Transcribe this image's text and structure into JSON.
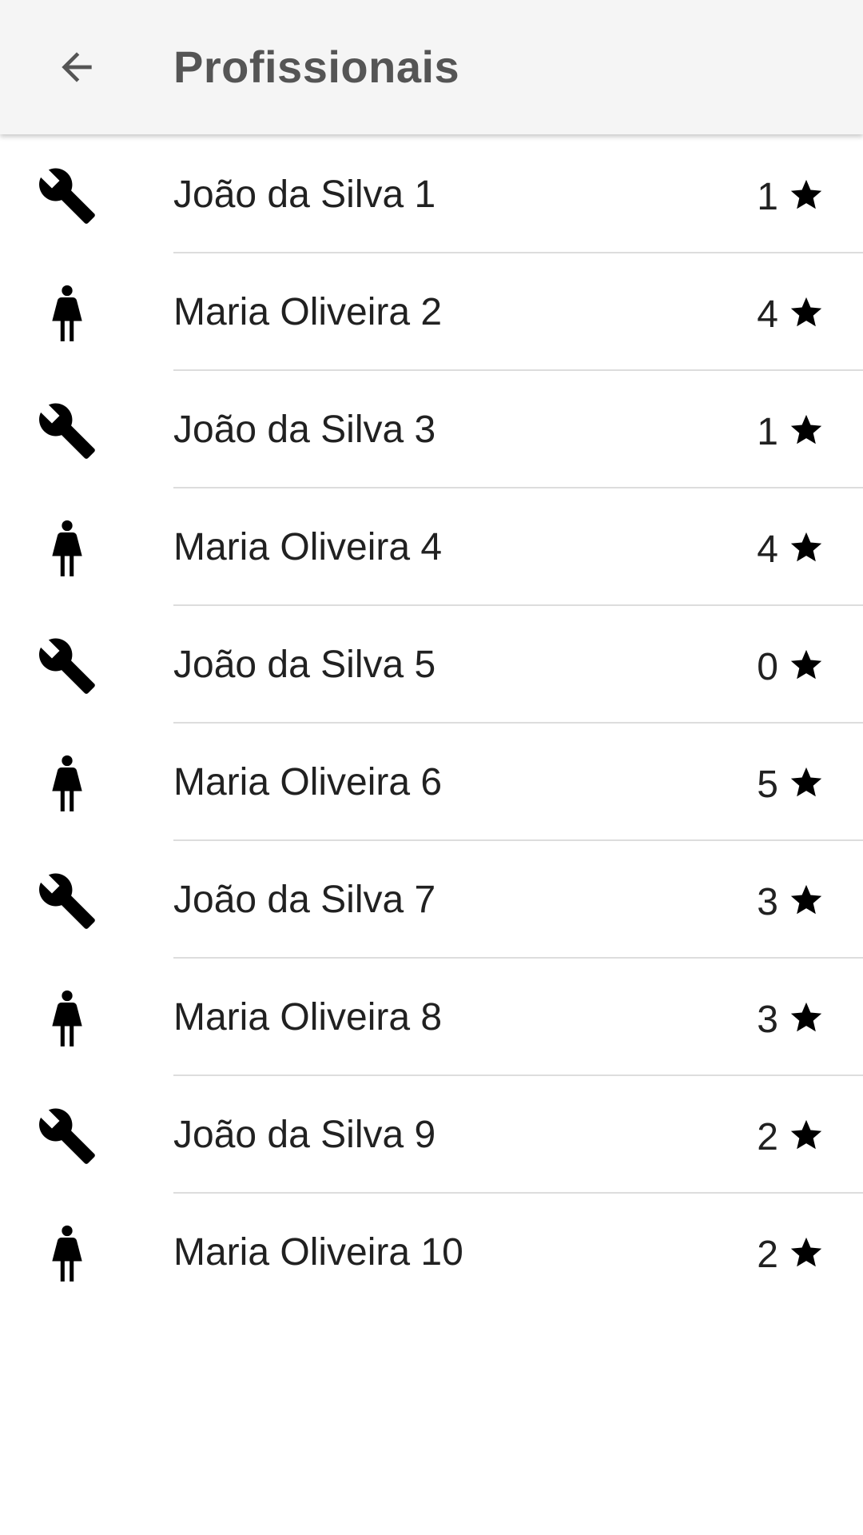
{
  "app_bar": {
    "title": "Profissionais",
    "back_icon": "arrow-back-icon"
  },
  "colors": {
    "app_bar_background": "#f5f5f5",
    "title_text": "#555555",
    "item_text": "#212121",
    "divider": "#dddddd"
  },
  "professionals": [
    {
      "name": "João da Silva 1",
      "rating": "1",
      "icon": "wrench-icon"
    },
    {
      "name": "Maria Oliveira 2",
      "rating": "4",
      "icon": "woman-icon"
    },
    {
      "name": "João da Silva 3",
      "rating": "1",
      "icon": "wrench-icon"
    },
    {
      "name": "Maria Oliveira 4",
      "rating": "4",
      "icon": "woman-icon"
    },
    {
      "name": "João da Silva 5",
      "rating": "0",
      "icon": "wrench-icon"
    },
    {
      "name": "Maria Oliveira 6",
      "rating": "5",
      "icon": "woman-icon"
    },
    {
      "name": "João da Silva 7",
      "rating": "3",
      "icon": "wrench-icon"
    },
    {
      "name": "Maria Oliveira 8",
      "rating": "3",
      "icon": "woman-icon"
    },
    {
      "name": "João da Silva 9",
      "rating": "2",
      "icon": "wrench-icon"
    },
    {
      "name": "Maria Oliveira 10",
      "rating": "2",
      "icon": "woman-icon"
    }
  ]
}
